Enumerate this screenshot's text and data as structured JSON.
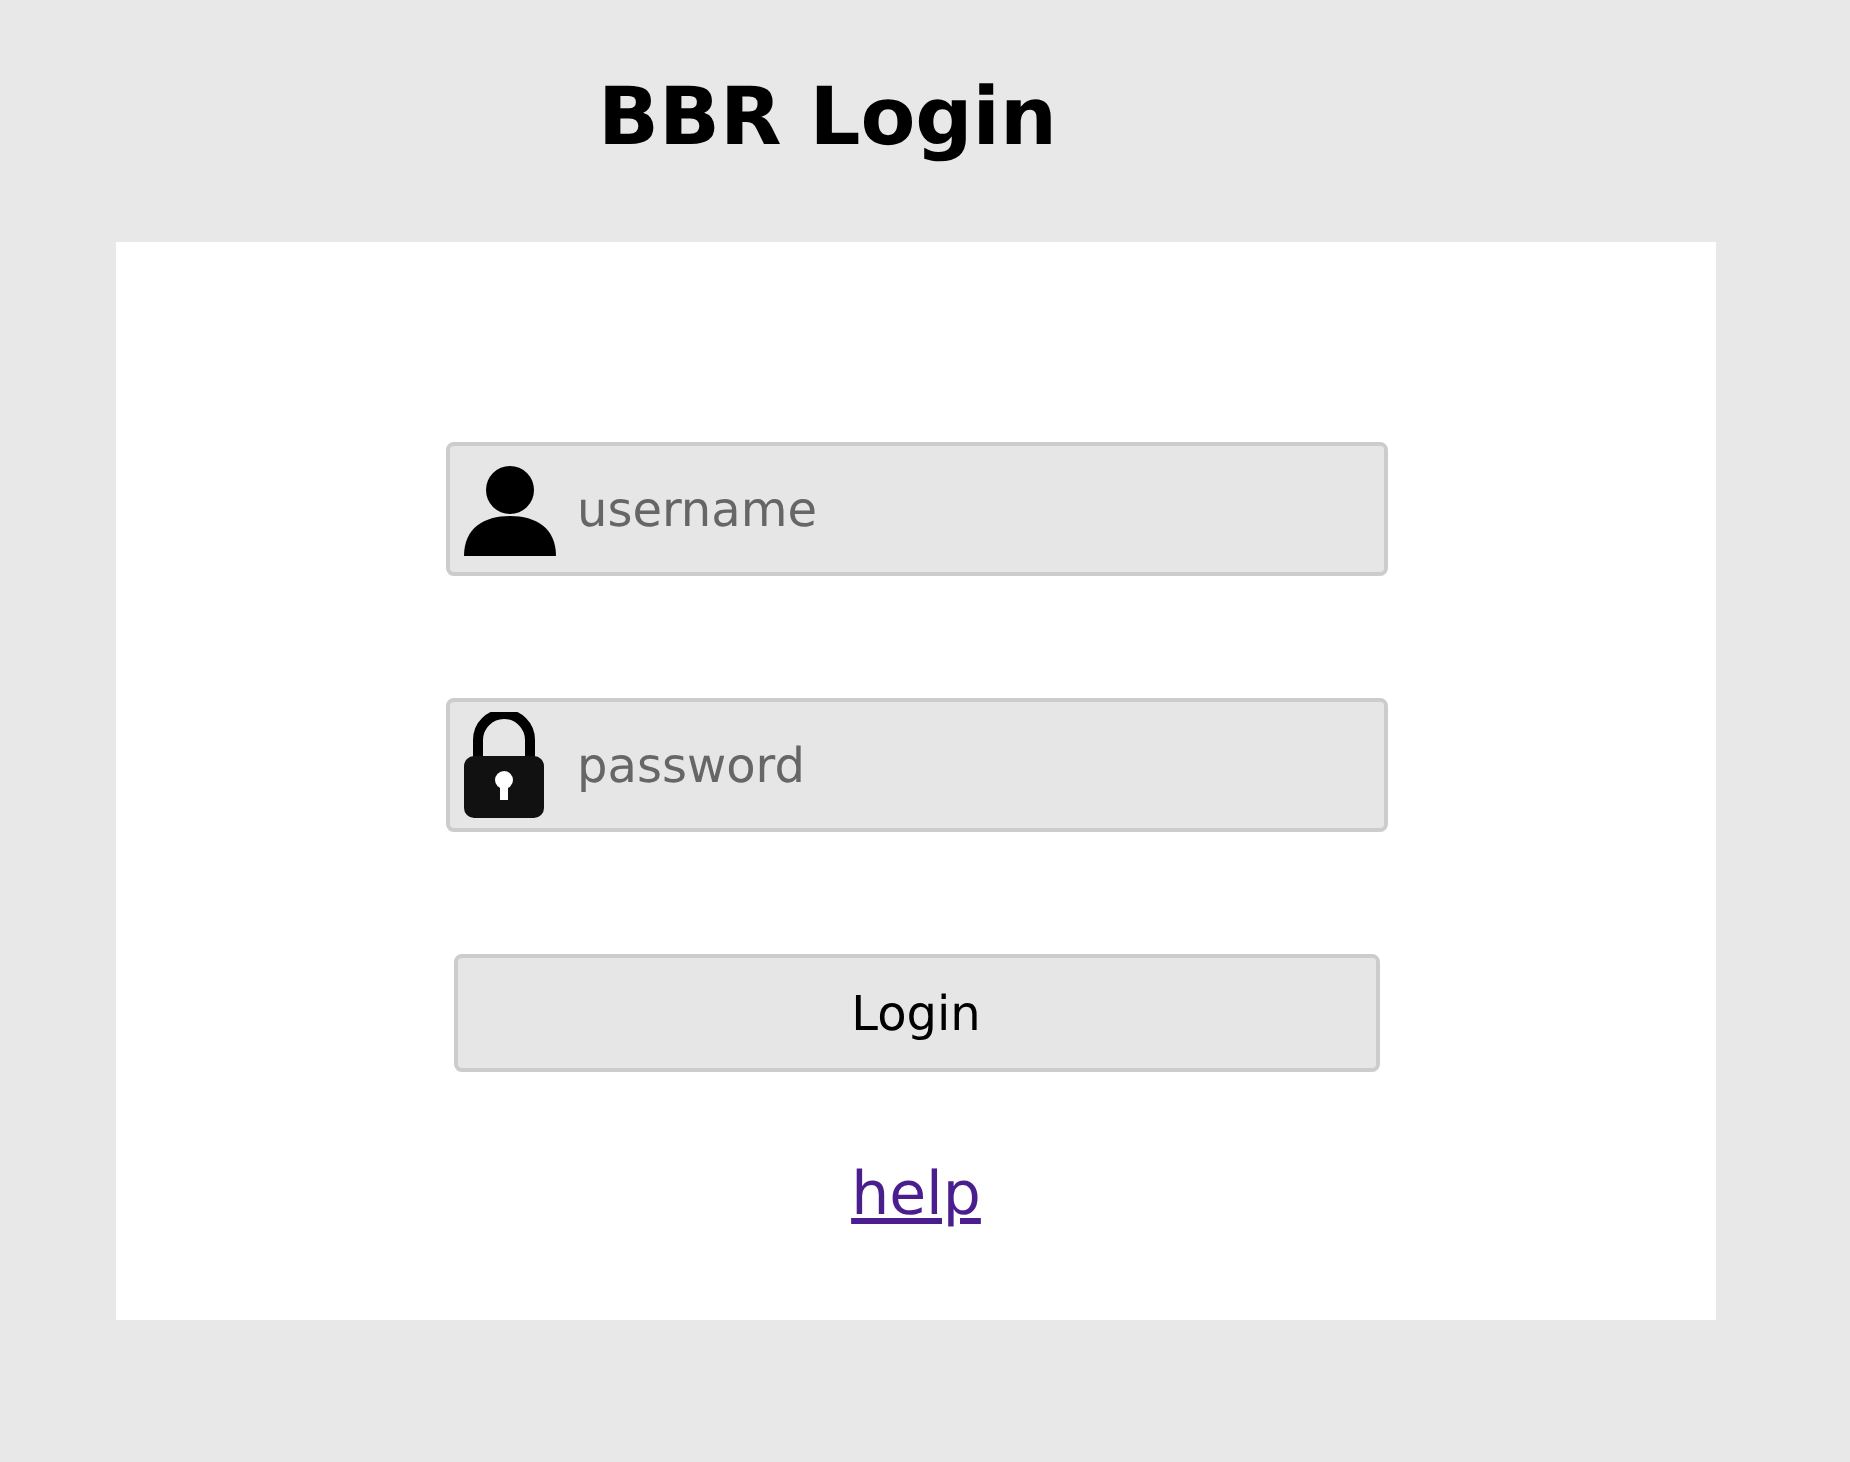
{
  "title": "BBR Login",
  "fields": [
    {
      "kind": "username",
      "placeholder": "username"
    },
    {
      "kind": "password",
      "placeholder": "password"
    }
  ],
  "button": {
    "label": "Login"
  },
  "link": {
    "label": "help"
  }
}
